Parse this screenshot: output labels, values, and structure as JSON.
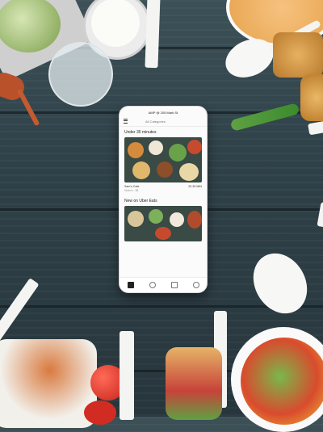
{
  "phone": {
    "status_time": "AMP @ 205 Mark St",
    "header_hint": "All Categories",
    "section1_title": "Under 30 minutes",
    "restaurant_name": "Sam's Cafe",
    "restaurant_sub": "Modern - $$",
    "restaurant_time": "20-30 MIN",
    "section2_title": "New on Uber Eats"
  },
  "tabs": [
    "home-icon",
    "search-icon",
    "orders-icon",
    "profile-icon"
  ],
  "colors": {
    "wood": "#2f4148",
    "phone_bg": "#fbfbfb",
    "tile_green": "#3a4a44"
  }
}
